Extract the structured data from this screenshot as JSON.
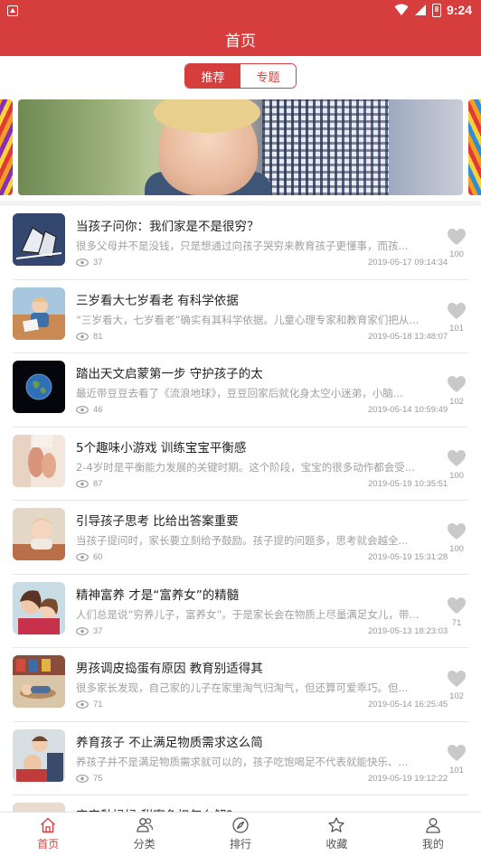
{
  "status_bar": {
    "time": "9:24",
    "battery_level": "8"
  },
  "header": {
    "title": "首页"
  },
  "segment": {
    "tabs": [
      "推荐",
      "专题"
    ],
    "active_index": 0
  },
  "articles": [
    {
      "title": "当孩子问你：我们家是不是很穷？",
      "desc": "很多父母并不是没钱，只是想通过向孩子哭穷来教育孩子更懂事，而孩...",
      "views": "37",
      "date": "2019-05-17 09:14:34",
      "likes": "100",
      "thumb": "dolls-illustration"
    },
    {
      "title": "三岁看大七岁看老 有科学依据",
      "desc": "“三岁看大，七岁看老”确实有其科学依据。儿童心理专家和教育家们把从...",
      "views": "81",
      "date": "2019-05-18 13:48:07",
      "likes": "101",
      "thumb": "child-reading"
    },
    {
      "title": "踏出天文启蒙第一步 守护孩子的太",
      "desc": "最近带豆豆去看了《流浪地球》，豆豆回家后就化身太空小迷弟，小脑...",
      "views": "46",
      "date": "2019-05-14 10:59:49",
      "likes": "102",
      "thumb": "earth"
    },
    {
      "title": "5个趣味小游戏 训练宝宝平衡感",
      "desc": "2-4岁时是平衡能力发展的关键时期。这个阶段，宝宝的很多动作都会受...",
      "views": "87",
      "date": "2019-05-19 10:35:51",
      "likes": "100",
      "thumb": "baby-feet"
    },
    {
      "title": "引导孩子思考 比给出答案重要",
      "desc": "当孩子提问时，家长要立刻给予鼓励。孩子提的问题多，思考就会越全...",
      "views": "60",
      "date": "2019-05-19 15:31:28",
      "likes": "100",
      "thumb": "thinking-child"
    },
    {
      "title": "精神富养 才是“富养女”的精髓",
      "desc": "人们总是说“穷养儿子，富养女”。于是家长会在物质上尽量满足女儿，带...",
      "views": "37",
      "date": "2019-05-13 18:23:03",
      "likes": "71",
      "thumb": "mother-daughter"
    },
    {
      "title": "男孩调皮捣蛋有原因 教育别适得其",
      "desc": "很多家长发现，自己家的儿子在家里淘气归淘气，但还算可爱乖巧。但...",
      "views": "71",
      "date": "2019-05-14 16:25:45",
      "likes": "102",
      "thumb": "boy-playroom"
    },
    {
      "title": "养育孩子 不止满足物质需求这么简",
      "desc": "养孩子并不是满足物质需求就可以的，孩子吃饱喝足不代表就能快乐、...",
      "views": "75",
      "date": "2019-05-19 19:12:22",
      "likes": "101",
      "thumb": "father-son"
    },
    {
      "title": "宝宝黏妈妈 甜蜜负担怎么解？",
      "desc": "",
      "views": "",
      "date": "",
      "likes": "",
      "thumb": "mother-baby"
    }
  ],
  "bottom_nav": [
    {
      "label": "首页",
      "icon": "home-icon",
      "active": true
    },
    {
      "label": "分类",
      "icon": "category-icon",
      "active": false
    },
    {
      "label": "排行",
      "icon": "compass-icon",
      "active": false
    },
    {
      "label": "收藏",
      "icon": "star-icon",
      "active": false
    },
    {
      "label": "我的",
      "icon": "person-icon",
      "active": false
    }
  ],
  "colors": {
    "primary": "#d63e3e",
    "text": "#222222",
    "muted": "#a0a0a0",
    "icon_gray": "#bdbdbd"
  }
}
